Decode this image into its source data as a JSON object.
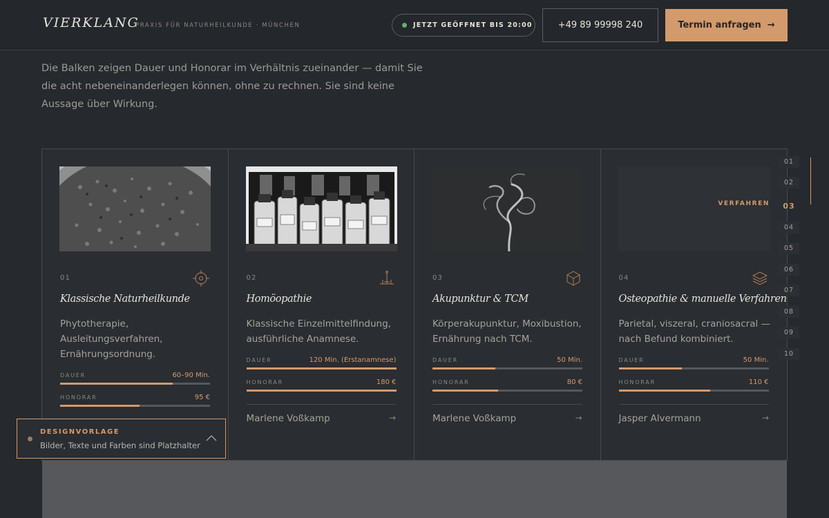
{
  "header": {
    "brand": "VIERKLANG",
    "subtitle": "PRAXIS FÜR NATURHEILKUNDE · MÜNCHEN",
    "status": "JETZT GEÖFFNET BIS 20:00",
    "phone": "+49 89 99998 240",
    "cta_label": "Termin anfragen",
    "cta_arrow": "→"
  },
  "intro": "Die Balken zeigen Dauer und Honorar im Verhältnis zueinander — damit Sie die acht nebeneinanderlegen können, ohne zu rechnen. Sie sind keine Aussage über Wirkung.",
  "cards": [
    {
      "number": "01",
      "icon": "crosshair-icon",
      "title": "Klassische Naturheilkunde",
      "description": "Phytotherapie, Ausleitungsverfahren, Ernährungsordnung.",
      "duration_label": "DAUER",
      "duration_value": "60–90 Min.",
      "duration_fraction": 0.75,
      "fee_label": "HONORAR",
      "fee_value": "95 €",
      "fee_fraction": 0.53,
      "author": "",
      "arrow": ""
    },
    {
      "number": "02",
      "icon": "lab-stand-icon",
      "title": "Homöopathie",
      "description": "Klassische Einzelmittelfindung, ausführliche Anamnese.",
      "duration_label": "DAUER",
      "duration_value": "120 Min. (Erstanamnese)",
      "duration_fraction": 1.0,
      "fee_label": "HONORAR",
      "fee_value": "180 €",
      "fee_fraction": 1.0,
      "author": "Marlene Voßkamp",
      "arrow": "→"
    },
    {
      "number": "03",
      "icon": "hexagon-cube-icon",
      "title": "Akupunktur & TCM",
      "description": "Körperakupunktur, Moxibustion, Ernährung nach TCM.",
      "duration_label": "DAUER",
      "duration_value": "50 Min.",
      "duration_fraction": 0.42,
      "fee_label": "HONORAR",
      "fee_value": "80 €",
      "fee_fraction": 0.44,
      "author": "Marlene Voßkamp",
      "arrow": "→"
    },
    {
      "number": "04",
      "icon": "layers-icon",
      "title": "Osteopathie & manuelle Verfahren",
      "description": "Parietal, viszeral, craniosacral — nach Befund kombiniert.",
      "duration_label": "DAUER",
      "duration_value": "50 Min.",
      "duration_fraction": 0.42,
      "fee_label": "HONORAR",
      "fee_value": "110 €",
      "fee_fraction": 0.61,
      "author": "Jasper Alvermann",
      "arrow": "→",
      "tag": "VERFAHREN"
    }
  ],
  "sidenav": [
    "01",
    "02",
    "03",
    "04",
    "05",
    "06",
    "07",
    "08",
    "09",
    "10"
  ],
  "sidenav_active": "03",
  "badge": {
    "title": "DESIGNVORLAGE",
    "text": "Bilder, Texte und Farben sind Platzhalter"
  },
  "colors": {
    "accent": "#d39a6c",
    "background": "#26292d",
    "status_dot": "#5fb26a"
  }
}
